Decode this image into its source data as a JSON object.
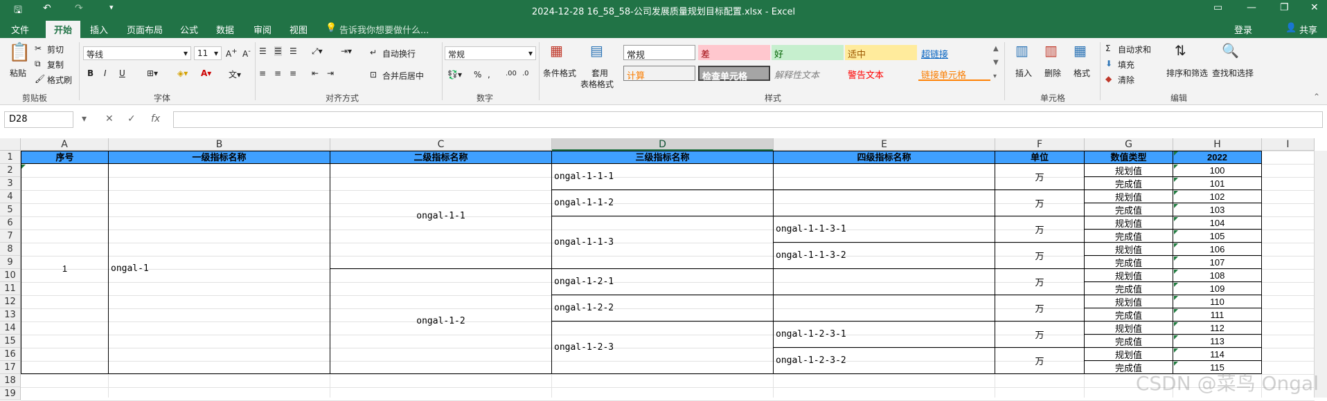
{
  "titlebar": {
    "title": "2024-12-28 16_58_58-公司发展质量规划目标配置.xlsx - Excel",
    "save_icon": "save-icon",
    "undo_icon": "undo-icon",
    "redo_icon": "redo-icon"
  },
  "menu": {
    "items": [
      "文件",
      "开始",
      "插入",
      "页面布局",
      "公式",
      "数据",
      "审阅",
      "视图"
    ],
    "tell": "告诉我你想要做什么...",
    "login": "登录",
    "share": "共享"
  },
  "ribbon": {
    "clipboard": {
      "paste": "粘贴",
      "cut": "剪切",
      "copy": "复制",
      "painter": "格式刷",
      "label": "剪贴板"
    },
    "font": {
      "name": "等线",
      "size": "11",
      "label": "字体",
      "bold": "B",
      "italic": "I",
      "underline": "U"
    },
    "align": {
      "wrap": "自动换行",
      "merge": "合并后居中",
      "label": "对齐方式"
    },
    "number": {
      "format": "常规",
      "label": "数字",
      "percent": "%"
    },
    "styles": {
      "cond": "条件格式",
      "table1": "套用",
      "table2": "表格格式",
      "cells": [
        "常规",
        "差",
        "好",
        "适中",
        "超链接",
        "计算",
        "检查单元格",
        "解释性文本",
        "警告文本",
        "链接单元格"
      ],
      "label": "样式"
    },
    "cells": {
      "insert": "插入",
      "delete": "删除",
      "format": "格式",
      "label": "单元格"
    },
    "editing": {
      "autosum": "自动求和",
      "fill": "填充",
      "clear": "清除",
      "sort": "排序和筛选",
      "find": "查找和选择",
      "label": "编辑"
    }
  },
  "formula": {
    "namebox": "D28",
    "fx": "fx",
    "value": ""
  },
  "columns": [
    "A",
    "B",
    "C",
    "D",
    "E",
    "F",
    "G",
    "H",
    "I"
  ],
  "rows": [
    "1",
    "2",
    "3",
    "4",
    "5",
    "6",
    "7",
    "8",
    "9",
    "10",
    "11",
    "12",
    "13",
    "14",
    "15",
    "16",
    "17",
    "18",
    "19"
  ],
  "sheet": {
    "headers": [
      "序号",
      "一级指标名称",
      "二级指标名称",
      "三级指标名称",
      "四级指标名称",
      "单位",
      "数值类型",
      "2022"
    ],
    "a_value": "1",
    "b_value": "ongal-1",
    "c_values": [
      "ongal-1-1",
      "ongal-1-2"
    ],
    "d_values": [
      "ongal-1-1-1",
      "ongal-1-1-2",
      "ongal-1-1-3",
      "ongal-1-2-1",
      "ongal-1-2-2",
      "ongal-1-2-3"
    ],
    "e_values": [
      "",
      "",
      "ongal-1-1-3-1",
      "ongal-1-1-3-2",
      "",
      "",
      "ongal-1-2-3-1",
      "ongal-1-2-3-2"
    ],
    "unit": "万",
    "types": [
      "规划值",
      "完成值"
    ],
    "h_values": [
      "100",
      "101",
      "102",
      "103",
      "104",
      "105",
      "106",
      "107",
      "108",
      "109",
      "110",
      "111",
      "112",
      "113",
      "114",
      "115"
    ]
  },
  "watermark": "CSDN @菜鸟 Ongal"
}
